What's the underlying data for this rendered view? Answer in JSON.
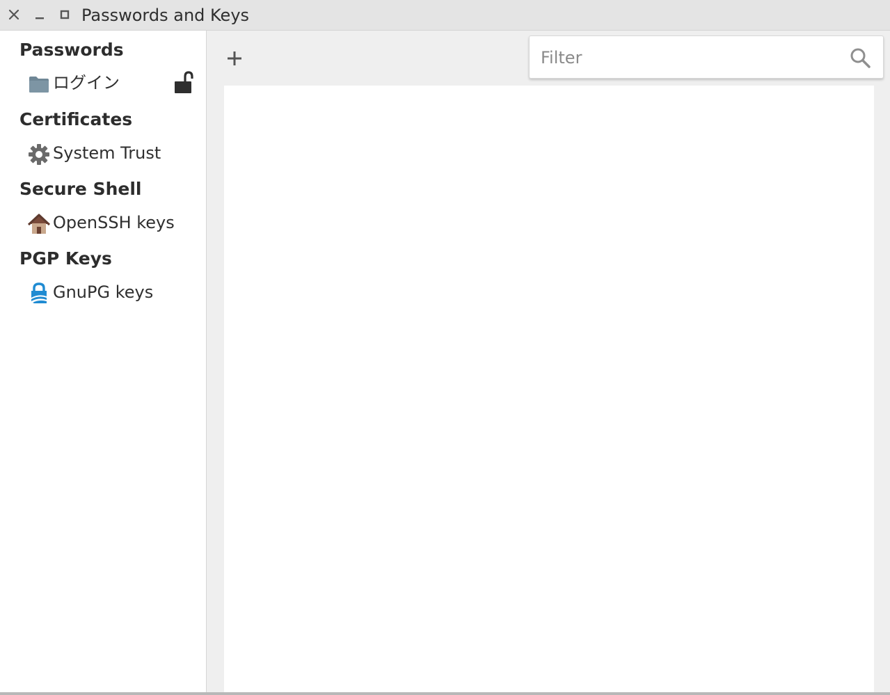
{
  "window": {
    "title": "Passwords and Keys"
  },
  "sidebar": {
    "sections": [
      {
        "header": "Passwords",
        "items": [
          {
            "label": "ログイン",
            "icon": "folder-icon",
            "status_icon": "unlocked-padlock-icon"
          }
        ]
      },
      {
        "header": "Certificates",
        "items": [
          {
            "label": "System Trust",
            "icon": "gear-icon"
          }
        ]
      },
      {
        "header": "Secure Shell",
        "items": [
          {
            "label": "OpenSSH keys",
            "icon": "home-icon"
          }
        ]
      },
      {
        "header": "PGP Keys",
        "items": [
          {
            "label": "GnuPG keys",
            "icon": "gnupg-icon"
          }
        ]
      }
    ]
  },
  "toolbar": {
    "add_icon": "plus-icon",
    "filter": {
      "placeholder": "Filter",
      "value": "",
      "icon": "search-icon"
    }
  },
  "colors": {
    "titlebar_bg": "#e4e4e4",
    "main_bg": "#efefef",
    "folder": "#6f8796",
    "gnupg_blue": "#1f8bd2",
    "home_roof": "#7a4a3a"
  }
}
